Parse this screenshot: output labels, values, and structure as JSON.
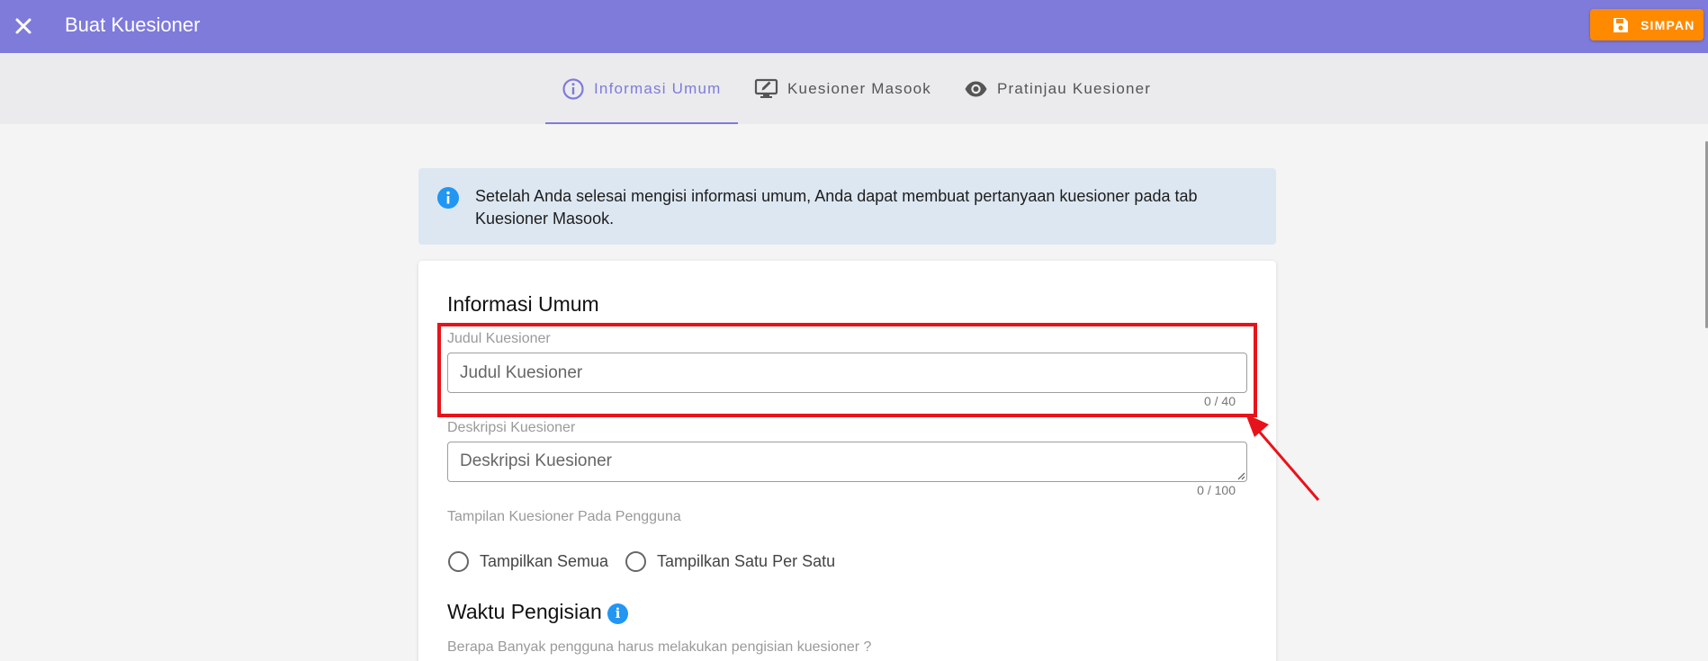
{
  "header": {
    "title": "Buat Kuesioner",
    "close_icon": "close-icon",
    "save_label": "SIMPAN",
    "save_icon": "floppy-disk-icon",
    "bar_color": "#7f7bdb",
    "save_color": "#ff8a00"
  },
  "tabs": [
    {
      "label": "Informasi Umum",
      "icon": "info-circle-icon",
      "active": true
    },
    {
      "label": "Kuesioner Masook",
      "icon": "monitor-edit-icon",
      "active": false
    },
    {
      "label": "Pratinjau Kuesioner",
      "icon": "eye-icon",
      "active": false
    }
  ],
  "alert": {
    "icon": "info-icon",
    "text": "Setelah Anda selesai mengisi informasi umum, Anda dapat membuat pertanyaan kuesioner pada tab Kuesioner Masook.",
    "bg_color": "#dde7f2"
  },
  "form": {
    "section_title": "Informasi Umum",
    "title_field": {
      "label": "Judul Kuesioner",
      "placeholder": "Judul Kuesioner",
      "value": "",
      "counter": "0 / 40"
    },
    "description_field": {
      "label": "Deskripsi Kuesioner",
      "placeholder": "Deskripsi Kuesioner",
      "value": "",
      "counter": "0 / 100"
    },
    "display_mode": {
      "label": "Tampilan Kuesioner Pada Pengguna",
      "options": [
        "Tampilkan Semua",
        "Tampilkan Satu Per Satu"
      ],
      "selected": null
    },
    "fill_time": {
      "title": "Waktu Pengisian",
      "info_icon": "info-icon",
      "question": "Berapa Banyak pengguna harus melakukan pengisian kuesioner ?"
    }
  },
  "annotation": {
    "highlight_color": "#e8131a"
  }
}
